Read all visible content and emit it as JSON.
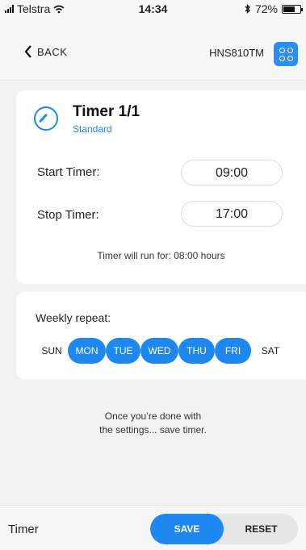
{
  "status_bar": {
    "carrier": "Telstra",
    "time": "14:34",
    "battery_text": "72%",
    "battery_level": 0.72,
    "icons": [
      "signal-icon",
      "wifi-icon",
      "bluetooth-icon",
      "battery-icon"
    ]
  },
  "nav": {
    "back_label": "BACK",
    "model": "HNS810TM",
    "device_icon": "device-grid-icon"
  },
  "timer": {
    "title": "Timer 1/1",
    "subtitle": "Standard",
    "icon": "timer-icon",
    "start_label": "Start Timer:",
    "start_value": "09:00",
    "stop_label": "Stop Timer:",
    "stop_value": "17:00",
    "runtime_text": "Timer will run for: 08:00 hours"
  },
  "repeat": {
    "label": "Weekly repeat:",
    "days": [
      {
        "label": "SUN",
        "selected": false
      },
      {
        "label": "MON",
        "selected": true
      },
      {
        "label": "TUE",
        "selected": true
      },
      {
        "label": "WED",
        "selected": true
      },
      {
        "label": "THU",
        "selected": true
      },
      {
        "label": "FRI",
        "selected": true
      },
      {
        "label": "SAT",
        "selected": false
      }
    ]
  },
  "hint": {
    "line1": "Once you’re done with",
    "line2": "the settings... save timer."
  },
  "footer": {
    "label": "Timer",
    "save_label": "SAVE",
    "reset_label": "RESET"
  },
  "colors": {
    "accent": "#1f87f0",
    "background": "#f2f2f2",
    "card": "#ffffff"
  }
}
